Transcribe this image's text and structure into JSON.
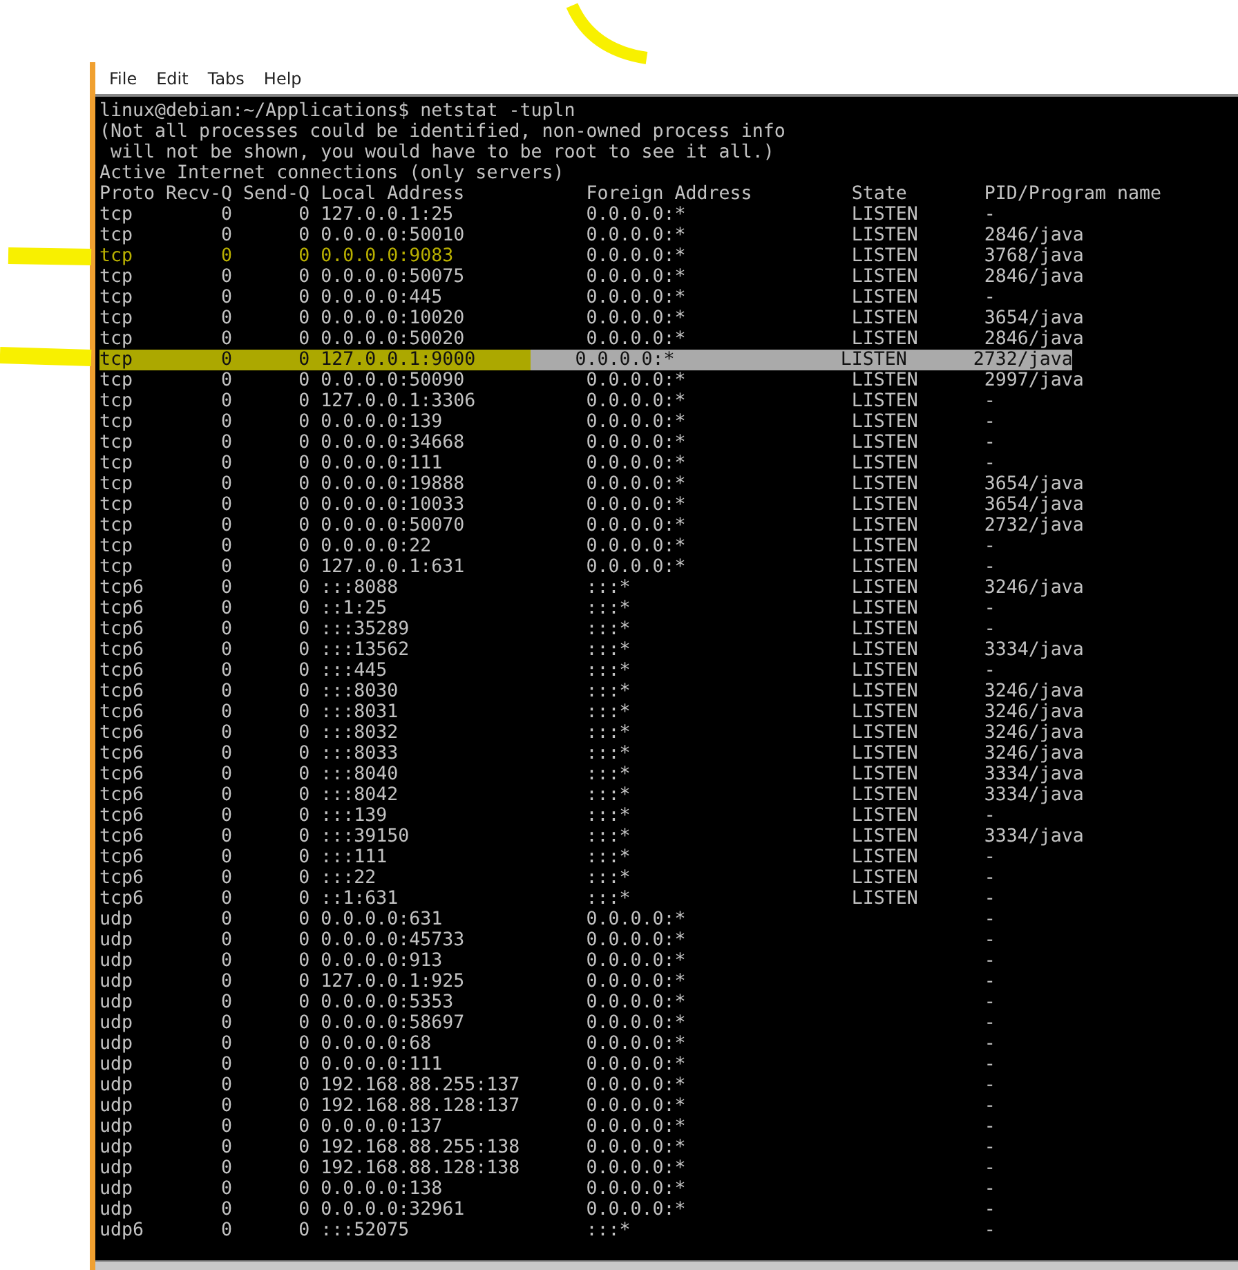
{
  "menu": [
    "File",
    "Edit",
    "Tabs",
    "Help"
  ],
  "terminal": {
    "prompt": "linux@debian:~/Applications$ netstat -tupln",
    "messages": [
      "(Not all processes could be identified, non-owned process info",
      " will not be shown, you would have to be root to see it all.)",
      "Active Internet connections (only servers)"
    ],
    "columns": [
      "Proto",
      "Recv-Q",
      "Send-Q",
      "Local Address",
      "Foreign Address",
      "State",
      "PID/Program name"
    ],
    "rows": [
      {
        "proto": "tcp",
        "recv_q": "0",
        "send_q": "0",
        "local": "127.0.0.1:25",
        "foreign": "0.0.0.0:*",
        "state": "LISTEN",
        "pid": "-",
        "marked": false,
        "selected": false
      },
      {
        "proto": "tcp",
        "recv_q": "0",
        "send_q": "0",
        "local": "0.0.0.0:50010",
        "foreign": "0.0.0.0:*",
        "state": "LISTEN",
        "pid": "2846/java",
        "marked": false,
        "selected": false
      },
      {
        "proto": "tcp",
        "recv_q": "0",
        "send_q": "0",
        "local": "0.0.0.0:9083",
        "foreign": "0.0.0.0:*",
        "state": "LISTEN",
        "pid": "3768/java",
        "marked": true,
        "selected": false
      },
      {
        "proto": "tcp",
        "recv_q": "0",
        "send_q": "0",
        "local": "0.0.0.0:50075",
        "foreign": "0.0.0.0:*",
        "state": "LISTEN",
        "pid": "2846/java",
        "marked": false,
        "selected": false
      },
      {
        "proto": "tcp",
        "recv_q": "0",
        "send_q": "0",
        "local": "0.0.0.0:445",
        "foreign": "0.0.0.0:*",
        "state": "LISTEN",
        "pid": "-",
        "marked": false,
        "selected": false
      },
      {
        "proto": "tcp",
        "recv_q": "0",
        "send_q": "0",
        "local": "0.0.0.0:10020",
        "foreign": "0.0.0.0:*",
        "state": "LISTEN",
        "pid": "3654/java",
        "marked": false,
        "selected": false
      },
      {
        "proto": "tcp",
        "recv_q": "0",
        "send_q": "0",
        "local": "0.0.0.0:50020",
        "foreign": "0.0.0.0:*",
        "state": "LISTEN",
        "pid": "2846/java",
        "marked": false,
        "selected": false
      },
      {
        "proto": "tcp",
        "recv_q": "0",
        "send_q": "0",
        "local": "127.0.0.1:9000",
        "foreign": "0.0.0.0:*",
        "state": "LISTEN",
        "pid": "2732/java",
        "marked": true,
        "selected": true
      },
      {
        "proto": "tcp",
        "recv_q": "0",
        "send_q": "0",
        "local": "0.0.0.0:50090",
        "foreign": "0.0.0.0:*",
        "state": "LISTEN",
        "pid": "2997/java",
        "marked": false,
        "selected": false
      },
      {
        "proto": "tcp",
        "recv_q": "0",
        "send_q": "0",
        "local": "127.0.0.1:3306",
        "foreign": "0.0.0.0:*",
        "state": "LISTEN",
        "pid": "-",
        "marked": false,
        "selected": false
      },
      {
        "proto": "tcp",
        "recv_q": "0",
        "send_q": "0",
        "local": "0.0.0.0:139",
        "foreign": "0.0.0.0:*",
        "state": "LISTEN",
        "pid": "-",
        "marked": false,
        "selected": false
      },
      {
        "proto": "tcp",
        "recv_q": "0",
        "send_q": "0",
        "local": "0.0.0.0:34668",
        "foreign": "0.0.0.0:*",
        "state": "LISTEN",
        "pid": "-",
        "marked": false,
        "selected": false
      },
      {
        "proto": "tcp",
        "recv_q": "0",
        "send_q": "0",
        "local": "0.0.0.0:111",
        "foreign": "0.0.0.0:*",
        "state": "LISTEN",
        "pid": "-",
        "marked": false,
        "selected": false
      },
      {
        "proto": "tcp",
        "recv_q": "0",
        "send_q": "0",
        "local": "0.0.0.0:19888",
        "foreign": "0.0.0.0:*",
        "state": "LISTEN",
        "pid": "3654/java",
        "marked": false,
        "selected": false
      },
      {
        "proto": "tcp",
        "recv_q": "0",
        "send_q": "0",
        "local": "0.0.0.0:10033",
        "foreign": "0.0.0.0:*",
        "state": "LISTEN",
        "pid": "3654/java",
        "marked": false,
        "selected": false
      },
      {
        "proto": "tcp",
        "recv_q": "0",
        "send_q": "0",
        "local": "0.0.0.0:50070",
        "foreign": "0.0.0.0:*",
        "state": "LISTEN",
        "pid": "2732/java",
        "marked": false,
        "selected": false
      },
      {
        "proto": "tcp",
        "recv_q": "0",
        "send_q": "0",
        "local": "0.0.0.0:22",
        "foreign": "0.0.0.0:*",
        "state": "LISTEN",
        "pid": "-",
        "marked": false,
        "selected": false
      },
      {
        "proto": "tcp",
        "recv_q": "0",
        "send_q": "0",
        "local": "127.0.0.1:631",
        "foreign": "0.0.0.0:*",
        "state": "LISTEN",
        "pid": "-",
        "marked": false,
        "selected": false
      },
      {
        "proto": "tcp6",
        "recv_q": "0",
        "send_q": "0",
        "local": ":::8088",
        "foreign": ":::*",
        "state": "LISTEN",
        "pid": "3246/java",
        "marked": false,
        "selected": false
      },
      {
        "proto": "tcp6",
        "recv_q": "0",
        "send_q": "0",
        "local": "::1:25",
        "foreign": ":::*",
        "state": "LISTEN",
        "pid": "-",
        "marked": false,
        "selected": false
      },
      {
        "proto": "tcp6",
        "recv_q": "0",
        "send_q": "0",
        "local": ":::35289",
        "foreign": ":::*",
        "state": "LISTEN",
        "pid": "-",
        "marked": false,
        "selected": false
      },
      {
        "proto": "tcp6",
        "recv_q": "0",
        "send_q": "0",
        "local": ":::13562",
        "foreign": ":::*",
        "state": "LISTEN",
        "pid": "3334/java",
        "marked": false,
        "selected": false
      },
      {
        "proto": "tcp6",
        "recv_q": "0",
        "send_q": "0",
        "local": ":::445",
        "foreign": ":::*",
        "state": "LISTEN",
        "pid": "-",
        "marked": false,
        "selected": false
      },
      {
        "proto": "tcp6",
        "recv_q": "0",
        "send_q": "0",
        "local": ":::8030",
        "foreign": ":::*",
        "state": "LISTEN",
        "pid": "3246/java",
        "marked": false,
        "selected": false
      },
      {
        "proto": "tcp6",
        "recv_q": "0",
        "send_q": "0",
        "local": ":::8031",
        "foreign": ":::*",
        "state": "LISTEN",
        "pid": "3246/java",
        "marked": false,
        "selected": false
      },
      {
        "proto": "tcp6",
        "recv_q": "0",
        "send_q": "0",
        "local": ":::8032",
        "foreign": ":::*",
        "state": "LISTEN",
        "pid": "3246/java",
        "marked": false,
        "selected": false
      },
      {
        "proto": "tcp6",
        "recv_q": "0",
        "send_q": "0",
        "local": ":::8033",
        "foreign": ":::*",
        "state": "LISTEN",
        "pid": "3246/java",
        "marked": false,
        "selected": false
      },
      {
        "proto": "tcp6",
        "recv_q": "0",
        "send_q": "0",
        "local": ":::8040",
        "foreign": ":::*",
        "state": "LISTEN",
        "pid": "3334/java",
        "marked": false,
        "selected": false
      },
      {
        "proto": "tcp6",
        "recv_q": "0",
        "send_q": "0",
        "local": ":::8042",
        "foreign": ":::*",
        "state": "LISTEN",
        "pid": "3334/java",
        "marked": false,
        "selected": false
      },
      {
        "proto": "tcp6",
        "recv_q": "0",
        "send_q": "0",
        "local": ":::139",
        "foreign": ":::*",
        "state": "LISTEN",
        "pid": "-",
        "marked": false,
        "selected": false
      },
      {
        "proto": "tcp6",
        "recv_q": "0",
        "send_q": "0",
        "local": ":::39150",
        "foreign": ":::*",
        "state": "LISTEN",
        "pid": "3334/java",
        "marked": false,
        "selected": false
      },
      {
        "proto": "tcp6",
        "recv_q": "0",
        "send_q": "0",
        "local": ":::111",
        "foreign": ":::*",
        "state": "LISTEN",
        "pid": "-",
        "marked": false,
        "selected": false
      },
      {
        "proto": "tcp6",
        "recv_q": "0",
        "send_q": "0",
        "local": ":::22",
        "foreign": ":::*",
        "state": "LISTEN",
        "pid": "-",
        "marked": false,
        "selected": false
      },
      {
        "proto": "tcp6",
        "recv_q": "0",
        "send_q": "0",
        "local": "::1:631",
        "foreign": ":::*",
        "state": "LISTEN",
        "pid": "-",
        "marked": false,
        "selected": false
      },
      {
        "proto": "udp",
        "recv_q": "0",
        "send_q": "0",
        "local": "0.0.0.0:631",
        "foreign": "0.0.0.0:*",
        "pid": "-",
        "marked": false,
        "selected": false
      },
      {
        "proto": "udp",
        "recv_q": "0",
        "send_q": "0",
        "local": "0.0.0.0:45733",
        "foreign": "0.0.0.0:*",
        "pid": "-",
        "marked": false,
        "selected": false
      },
      {
        "proto": "udp",
        "recv_q": "0",
        "send_q": "0",
        "local": "0.0.0.0:913",
        "foreign": "0.0.0.0:*",
        "pid": "-",
        "marked": false,
        "selected": false
      },
      {
        "proto": "udp",
        "recv_q": "0",
        "send_q": "0",
        "local": "127.0.0.1:925",
        "foreign": "0.0.0.0:*",
        "pid": "-",
        "marked": false,
        "selected": false
      },
      {
        "proto": "udp",
        "recv_q": "0",
        "send_q": "0",
        "local": "0.0.0.0:5353",
        "foreign": "0.0.0.0:*",
        "pid": "-",
        "marked": false,
        "selected": false
      },
      {
        "proto": "udp",
        "recv_q": "0",
        "send_q": "0",
        "local": "0.0.0.0:58697",
        "foreign": "0.0.0.0:*",
        "pid": "-",
        "marked": false,
        "selected": false
      },
      {
        "proto": "udp",
        "recv_q": "0",
        "send_q": "0",
        "local": "0.0.0.0:68",
        "foreign": "0.0.0.0:*",
        "pid": "-",
        "marked": false,
        "selected": false
      },
      {
        "proto": "udp",
        "recv_q": "0",
        "send_q": "0",
        "local": "0.0.0.0:111",
        "foreign": "0.0.0.0:*",
        "pid": "-",
        "marked": false,
        "selected": false
      },
      {
        "proto": "udp",
        "recv_q": "0",
        "send_q": "0",
        "local": "192.168.88.255:137",
        "foreign": "0.0.0.0:*",
        "pid": "-",
        "marked": false,
        "selected": false
      },
      {
        "proto": "udp",
        "recv_q": "0",
        "send_q": "0",
        "local": "192.168.88.128:137",
        "foreign": "0.0.0.0:*",
        "pid": "-",
        "marked": false,
        "selected": false
      },
      {
        "proto": "udp",
        "recv_q": "0",
        "send_q": "0",
        "local": "0.0.0.0:137",
        "foreign": "0.0.0.0:*",
        "pid": "-",
        "marked": false,
        "selected": false
      },
      {
        "proto": "udp",
        "recv_q": "0",
        "send_q": "0",
        "local": "192.168.88.255:138",
        "foreign": "0.0.0.0:*",
        "pid": "-",
        "marked": false,
        "selected": false
      },
      {
        "proto": "udp",
        "recv_q": "0",
        "send_q": "0",
        "local": "192.168.88.128:138",
        "foreign": "0.0.0.0:*",
        "pid": "-",
        "marked": false,
        "selected": false
      },
      {
        "proto": "udp",
        "recv_q": "0",
        "send_q": "0",
        "local": "0.0.0.0:138",
        "foreign": "0.0.0.0:*",
        "pid": "-",
        "marked": false,
        "selected": false
      },
      {
        "proto": "udp",
        "recv_q": "0",
        "send_q": "0",
        "local": "0.0.0.0:32961",
        "foreign": "0.0.0.0:*",
        "pid": "-",
        "marked": false,
        "selected": false
      },
      {
        "proto": "udp6",
        "recv_q": "0",
        "send_q": "0",
        "local": ":::52075",
        "foreign": ":::*",
        "pid": "-",
        "marked": false,
        "selected": false
      }
    ]
  }
}
